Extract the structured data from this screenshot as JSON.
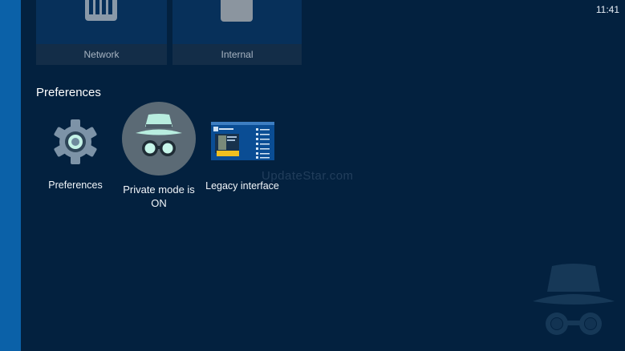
{
  "status_bar": {
    "time": "11:41"
  },
  "storage_tiles": [
    {
      "label": "Network",
      "icon": "network-storage-icon"
    },
    {
      "label": "Internal",
      "icon": "internal-storage-icon"
    }
  ],
  "preferences_section": {
    "title": "Preferences",
    "items": [
      {
        "label": "Preferences",
        "icon": "gear-icon"
      },
      {
        "label_line1": "Private mode is",
        "label_line2": "ON",
        "icon": "incognito-icon"
      },
      {
        "label": "Legacy interface",
        "icon": "legacy-interface-thumbnail"
      }
    ]
  },
  "watermark": "UpdateStar.com",
  "colors": {
    "background": "#03213f",
    "accent_bar": "#0b61a8",
    "tile": "#07305a",
    "incognito_green": "#a5e8d8"
  }
}
